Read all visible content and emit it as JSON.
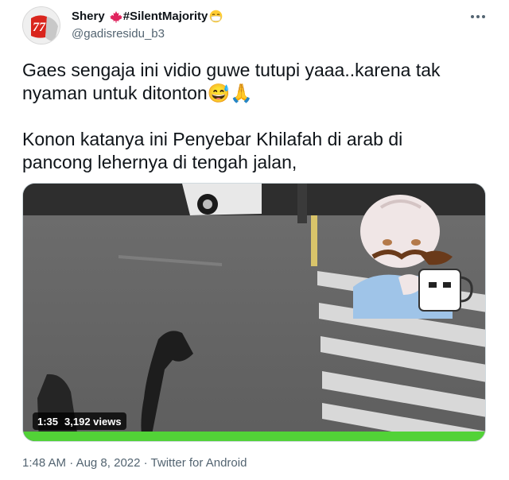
{
  "tweet": {
    "display_name": "Shery",
    "display_name_suffix": "#SilentMajority",
    "handle": "@gadisresidu_b3",
    "avatar_label": "77",
    "text_lines": [
      "Gaes sengaja ini vidio guwe tutupi yaaa..karena tak\nnyaman untuk ditonton😅🙏",
      "Konon katanya ini Penyebar Khilafah di arab di\npancong lehernya di tengah jalan,"
    ],
    "video": {
      "duration": "1:35",
      "views": "3,192 views"
    },
    "meta": {
      "time": "1:48 AM",
      "separator": "·",
      "date": "Aug 8, 2022",
      "source": "Twitter for Android"
    }
  },
  "colors": {
    "text_primary": "#0f1419",
    "text_secondary": "#536471",
    "border": "#cfd9de",
    "maple_red": "#e0245e",
    "progress_green": "#56d33a"
  },
  "icons": {
    "flag": "maple-leaf-icon",
    "mask": "mask-face-emoji",
    "more": "more-icon"
  }
}
